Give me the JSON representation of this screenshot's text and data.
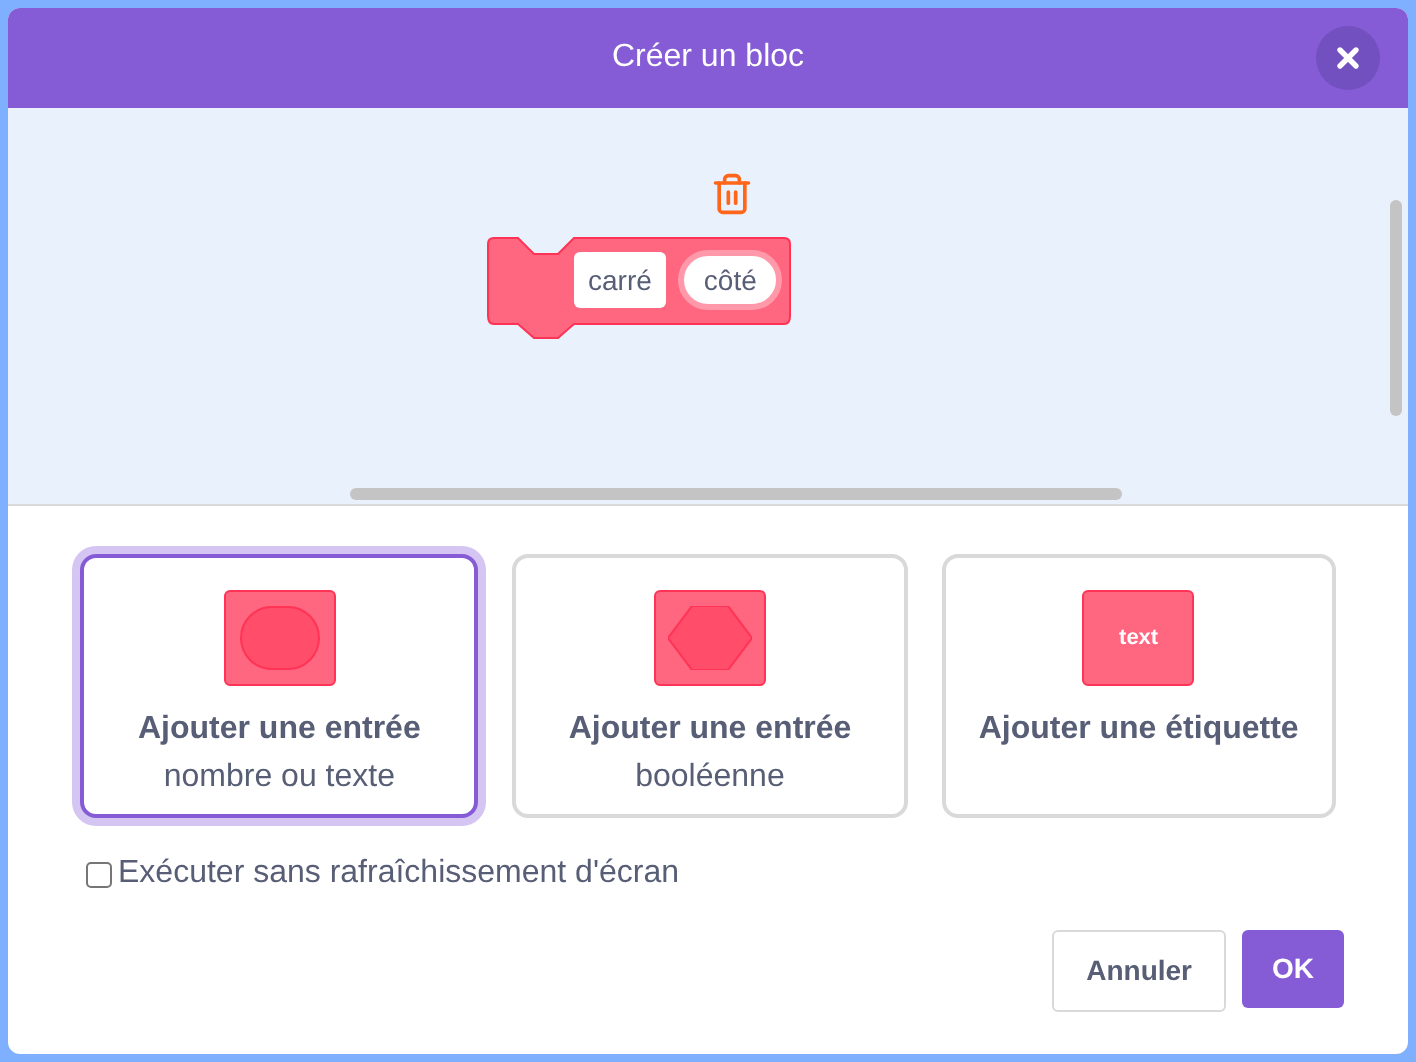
{
  "dialog": {
    "title": "Créer un bloc"
  },
  "block": {
    "label": "carré",
    "parameter": "côté"
  },
  "options": [
    {
      "kind": "number_text",
      "title": "Ajouter une entrée",
      "subtitle": "nombre ou texte",
      "selected": true
    },
    {
      "kind": "boolean",
      "title": "Ajouter une entrée",
      "subtitle": "booléenne",
      "selected": false
    },
    {
      "kind": "label",
      "title": "Ajouter une étiquette",
      "icon_text": "text",
      "selected": false
    }
  ],
  "run_without_refresh": {
    "label": "Exécuter sans rafraîchissement d'écran",
    "checked": false
  },
  "buttons": [
    {
      "kind": "cancel",
      "label": "Annuler"
    },
    {
      "kind": "ok",
      "label": "OK"
    }
  ]
}
